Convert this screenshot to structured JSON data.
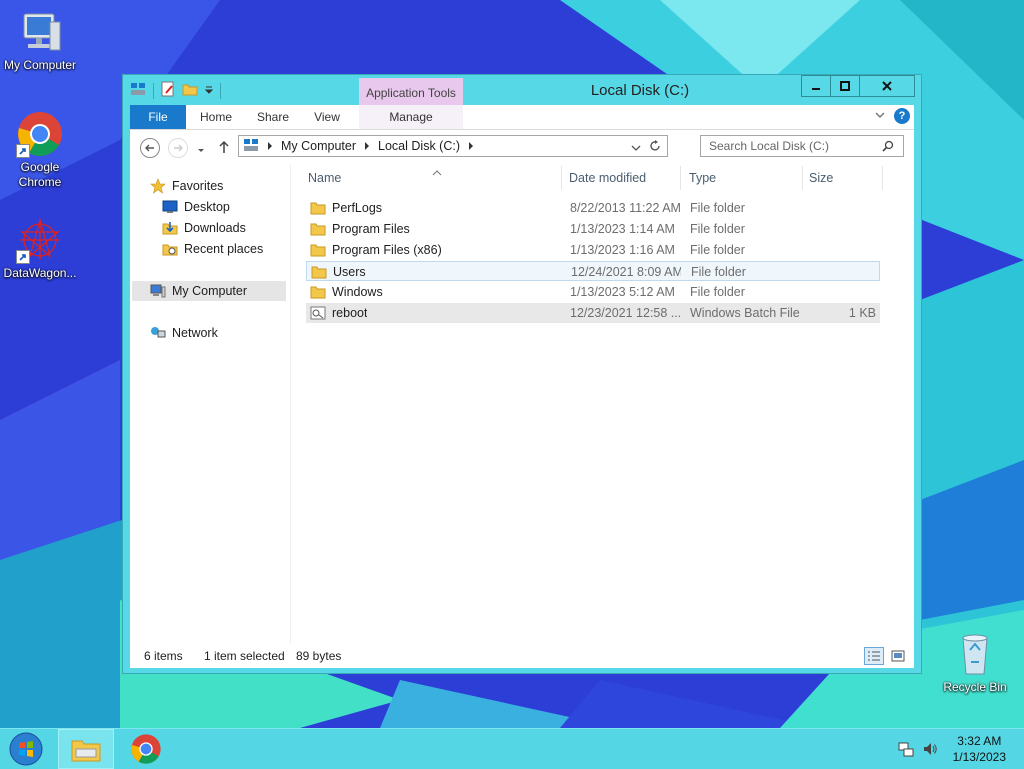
{
  "desktop": {
    "icons": [
      {
        "label": "My Computer"
      },
      {
        "label": "Google\nChrome"
      },
      {
        "label": "DataWagon..."
      },
      {
        "label": "Recycle Bin"
      }
    ]
  },
  "window": {
    "title": "Local Disk (C:)",
    "context_tab": "Application Tools",
    "buttons": {
      "minimize": "–",
      "maximize": "□",
      "close": "✕"
    }
  },
  "ribbon": {
    "tabs": [
      "File",
      "Home",
      "Share",
      "View",
      "Manage"
    ]
  },
  "navigation": {
    "breadcrumb": [
      "My Computer",
      "Local Disk (C:)"
    ],
    "search_placeholder": "Search Local Disk (C:)"
  },
  "nav_pane": {
    "favorites_label": "Favorites",
    "favorites": [
      "Desktop",
      "Downloads",
      "Recent places"
    ],
    "computer_label": "My Computer",
    "network_label": "Network"
  },
  "file_list": {
    "columns": [
      "Name",
      "Date modified",
      "Type",
      "Size"
    ],
    "rows": [
      {
        "name": "PerfLogs",
        "date": "8/22/2013 11:22 AM",
        "type": "File folder",
        "size": "",
        "icon": "folder-icon"
      },
      {
        "name": "Program Files",
        "date": "1/13/2023 1:14 AM",
        "type": "File folder",
        "size": "",
        "icon": "folder-icon"
      },
      {
        "name": "Program Files (x86)",
        "date": "1/13/2023 1:16 AM",
        "type": "File folder",
        "size": "",
        "icon": "folder-icon"
      },
      {
        "name": "Users",
        "date": "12/24/2021 8:09 AM",
        "type": "File folder",
        "size": "",
        "icon": "folder-icon",
        "state": "hover"
      },
      {
        "name": "Windows",
        "date": "1/13/2023 5:12 AM",
        "type": "File folder",
        "size": "",
        "icon": "folder-icon"
      },
      {
        "name": "reboot",
        "date": "12/23/2021 12:58 ...",
        "type": "Windows Batch File",
        "size": "1 KB",
        "icon": "batch-file-icon",
        "state": "selected"
      }
    ]
  },
  "status": {
    "item_count": "6 items",
    "selection": "1 item selected",
    "selection_size": "89 bytes"
  },
  "taskbar": {
    "time": "3:32 AM",
    "date": "1/13/2023"
  },
  "colors": {
    "accent": "#1979ca",
    "window_frame": "#56d8e6",
    "context_tab": "#e8c8ec"
  }
}
